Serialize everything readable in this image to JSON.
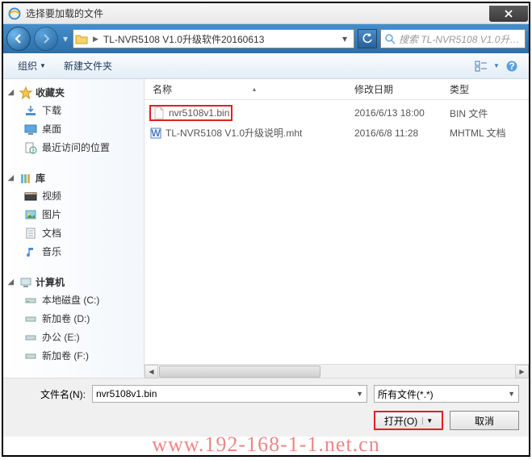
{
  "titlebar": {
    "title": "选择要加载的文件"
  },
  "breadcrumb": {
    "path": "TL-NVR5108 V1.0升级软件20160613"
  },
  "search": {
    "placeholder": "搜索 TL-NVR5108 V1.0升级..."
  },
  "toolbar": {
    "organize": "组织",
    "newfolder": "新建文件夹"
  },
  "sidebar": {
    "favorites": {
      "label": "收藏夹",
      "items": [
        "下载",
        "桌面",
        "最近访问的位置"
      ]
    },
    "libraries": {
      "label": "库",
      "items": [
        "视频",
        "图片",
        "文档",
        "音乐"
      ]
    },
    "computer": {
      "label": "计算机",
      "items": [
        "本地磁盘 (C:)",
        "新加卷 (D:)",
        "办公 (E:)",
        "新加卷 (F:)"
      ]
    }
  },
  "columns": {
    "name": "名称",
    "date": "修改日期",
    "type": "类型"
  },
  "files": [
    {
      "name": "nvr5108v1.bin",
      "date": "2016/6/13 18:00",
      "type": "BIN 文件",
      "highlight": true
    },
    {
      "name": "TL-NVR5108 V1.0升级说明.mht",
      "date": "2016/6/8 11:28",
      "type": "MHTML 文档",
      "highlight": false
    }
  ],
  "bottom": {
    "fn_label": "文件名(N):",
    "fn_value": "nvr5108v1.bin",
    "filter": "所有文件(*.*)",
    "open": "打开(O)",
    "cancel": "取消"
  },
  "watermark": "www.192-168-1-1.net.cn"
}
